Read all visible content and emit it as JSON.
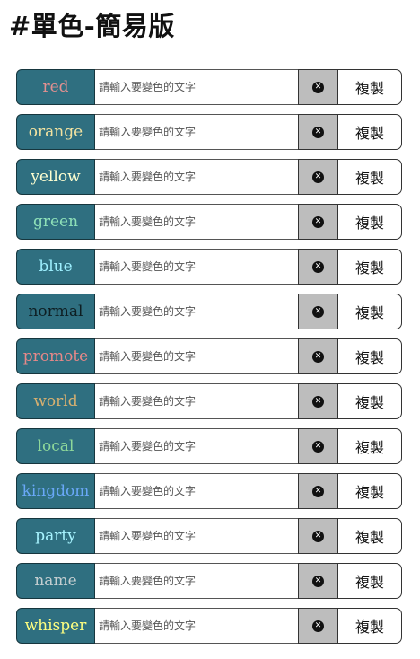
{
  "page": {
    "title": "#單色-簡易版"
  },
  "placeholder": "請輸入要變色的文字",
  "clear_icon": "close-circle-icon",
  "copy_label": "複製",
  "colors": [
    {
      "label": "red",
      "color": "#e39090"
    },
    {
      "label": "orange",
      "color": "#f2e2a0"
    },
    {
      "label": "yellow",
      "color": "#ffffd0"
    },
    {
      "label": "green",
      "color": "#8ee0b8"
    },
    {
      "label": "blue",
      "color": "#9ef0ff"
    },
    {
      "label": "normal",
      "color": "#0e1e22"
    },
    {
      "label": "promote",
      "color": "#e88888"
    },
    {
      "label": "world",
      "color": "#d8b070"
    },
    {
      "label": "local",
      "color": "#8ed89a"
    },
    {
      "label": "kingdom",
      "color": "#6aa8f8"
    },
    {
      "label": "party",
      "color": "#a8f4ff"
    },
    {
      "label": "name",
      "color": "#c4ced0"
    },
    {
      "label": "whisper",
      "color": "#ffff80"
    }
  ]
}
